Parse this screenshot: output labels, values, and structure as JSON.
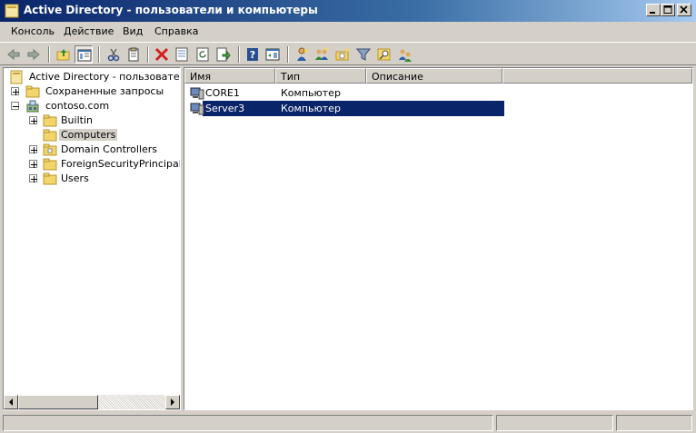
{
  "window": {
    "title": "Active Directory - пользователи и компьютеры",
    "icon": "ad-folder-icon",
    "controls": [
      "minimize-icon",
      "maximize-icon",
      "close-icon"
    ]
  },
  "menu": {
    "items": [
      "Консоль",
      "Действие",
      "Вид",
      "Справка"
    ]
  },
  "toolbar": {
    "buttons": [
      "back-icon",
      "forward-icon",
      "up-folder-icon",
      "show-console-tree-icon",
      "cut-icon",
      "copy-icon",
      "delete-icon",
      "properties-icon",
      "refresh-icon",
      "export-list-icon",
      "help-icon",
      "show-action-pane-icon",
      "new-user-icon",
      "new-group-icon",
      "new-ou-icon",
      "filter-icon",
      "find-icon",
      "delegate-icon"
    ],
    "pressed": "show-console-tree-icon"
  },
  "tree": {
    "root": "Active Directory - пользователи и",
    "saved_queries": "Сохраненные запросы",
    "domain": "contoso.com",
    "children": [
      "Builtin",
      "Computers",
      "Domain Controllers",
      "ForeignSecurityPrincipals",
      "Users"
    ],
    "selected": "Computers"
  },
  "list": {
    "columns": [
      "Имя",
      "Тип",
      "Описание"
    ],
    "rows": [
      {
        "name": "CORE1",
        "type": "Компьютер",
        "description": ""
      },
      {
        "name": "Server3",
        "type": "Компьютер",
        "description": ""
      }
    ],
    "selected_row": "Server3"
  },
  "colors": {
    "title_bar": "#0a246a",
    "selection": "#0a246a",
    "face": "#d4d0c8"
  }
}
